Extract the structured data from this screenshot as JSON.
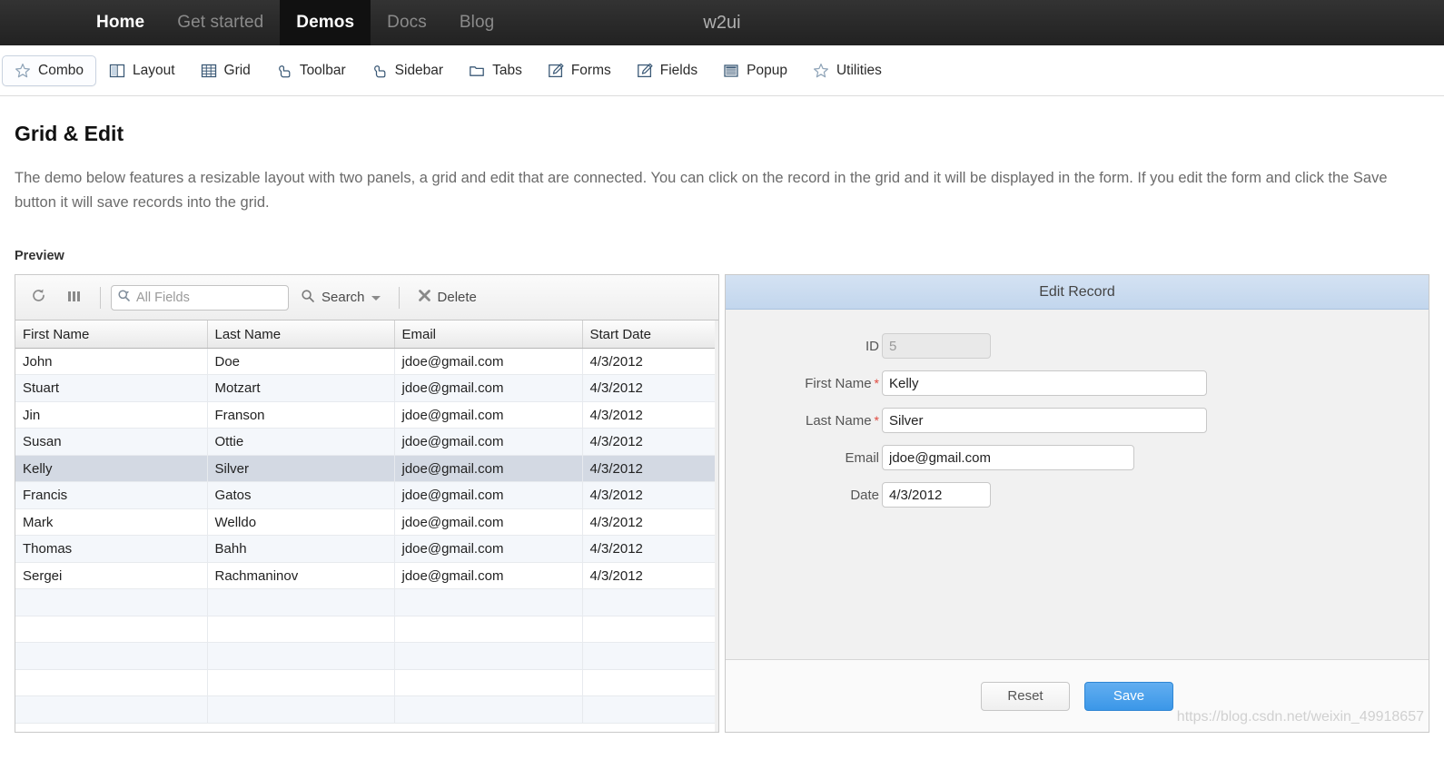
{
  "topnav": {
    "brand": "w2ui",
    "items": [
      {
        "label": "Home",
        "state": "white"
      },
      {
        "label": "Get started",
        "state": "dim"
      },
      {
        "label": "Demos",
        "state": "active"
      },
      {
        "label": "Docs",
        "state": "dim"
      },
      {
        "label": "Blog",
        "state": "dim"
      }
    ]
  },
  "subnav": {
    "items": [
      {
        "label": "Combo",
        "icon": "star-icon",
        "active": true
      },
      {
        "label": "Layout",
        "icon": "layout-icon",
        "active": false
      },
      {
        "label": "Grid",
        "icon": "grid-icon",
        "active": false
      },
      {
        "label": "Toolbar",
        "icon": "hand-icon",
        "active": false
      },
      {
        "label": "Sidebar",
        "icon": "hand-icon",
        "active": false
      },
      {
        "label": "Tabs",
        "icon": "folder-icon",
        "active": false
      },
      {
        "label": "Forms",
        "icon": "pencil-icon",
        "active": false
      },
      {
        "label": "Fields",
        "icon": "pencil-icon",
        "active": false
      },
      {
        "label": "Popup",
        "icon": "window-icon",
        "active": false
      },
      {
        "label": "Utilities",
        "icon": "star-icon",
        "active": false
      }
    ]
  },
  "page": {
    "title": "Grid & Edit",
    "description": "The demo below features a resizable layout with two panels, a grid and edit that are connected. You can click on the record in the grid and it will be displayed in the form. If you edit the form and click the Save button it will save records into the grid.",
    "preview_label": "Preview"
  },
  "grid": {
    "toolbar": {
      "refresh_icon": "refresh-icon",
      "columns_icon": "columns-icon",
      "search_placeholder": "All Fields",
      "search_value": "",
      "search_label": "Search",
      "delete_label": "Delete"
    },
    "columns": [
      "First Name",
      "Last Name",
      "Email",
      "Start Date"
    ],
    "rows": [
      {
        "first": "John",
        "last": "Doe",
        "email": "jdoe@gmail.com",
        "date": "4/3/2012",
        "selected": false
      },
      {
        "first": "Stuart",
        "last": "Motzart",
        "email": "jdoe@gmail.com",
        "date": "4/3/2012",
        "selected": false
      },
      {
        "first": "Jin",
        "last": "Franson",
        "email": "jdoe@gmail.com",
        "date": "4/3/2012",
        "selected": false
      },
      {
        "first": "Susan",
        "last": "Ottie",
        "email": "jdoe@gmail.com",
        "date": "4/3/2012",
        "selected": false
      },
      {
        "first": "Kelly",
        "last": "Silver",
        "email": "jdoe@gmail.com",
        "date": "4/3/2012",
        "selected": true
      },
      {
        "first": "Francis",
        "last": "Gatos",
        "email": "jdoe@gmail.com",
        "date": "4/3/2012",
        "selected": false
      },
      {
        "first": "Mark",
        "last": "Welldo",
        "email": "jdoe@gmail.com",
        "date": "4/3/2012",
        "selected": false
      },
      {
        "first": "Thomas",
        "last": "Bahh",
        "email": "jdoe@gmail.com",
        "date": "4/3/2012",
        "selected": false
      },
      {
        "first": "Sergei",
        "last": "Rachmaninov",
        "email": "jdoe@gmail.com",
        "date": "4/3/2012",
        "selected": false
      },
      {
        "first": "",
        "last": "",
        "email": "",
        "date": "",
        "selected": false
      },
      {
        "first": "",
        "last": "",
        "email": "",
        "date": "",
        "selected": false
      },
      {
        "first": "",
        "last": "",
        "email": "",
        "date": "",
        "selected": false
      },
      {
        "first": "",
        "last": "",
        "email": "",
        "date": "",
        "selected": false
      },
      {
        "first": "",
        "last": "",
        "email": "",
        "date": "",
        "selected": false
      }
    ]
  },
  "form": {
    "header": "Edit Record",
    "fields": [
      {
        "label": "ID",
        "value": "5",
        "required": false,
        "disabled": true,
        "width": "w-id"
      },
      {
        "label": "First Name",
        "value": "Kelly",
        "required": true,
        "disabled": false,
        "width": "w-name"
      },
      {
        "label": "Last Name",
        "value": "Silver",
        "required": true,
        "disabled": false,
        "width": "w-name"
      },
      {
        "label": "Email",
        "value": "jdoe@gmail.com",
        "required": false,
        "disabled": false,
        "width": "w-mail"
      },
      {
        "label": "Date",
        "value": "4/3/2012",
        "required": false,
        "disabled": false,
        "width": "w-date"
      }
    ],
    "buttons": {
      "reset": "Reset",
      "save": "Save"
    }
  },
  "watermark": "https://blog.csdn.net/weixin_49918657",
  "colors": {
    "nav_bg": "#2a2a2a",
    "nav_active_bg": "#111111",
    "accent_blue": "#3b97e8",
    "row_selected": "#d3d9e3",
    "row_alt": "#f4f7fb",
    "required_star": "#e04a3f",
    "form_header_blue": "#c2d6ed"
  }
}
